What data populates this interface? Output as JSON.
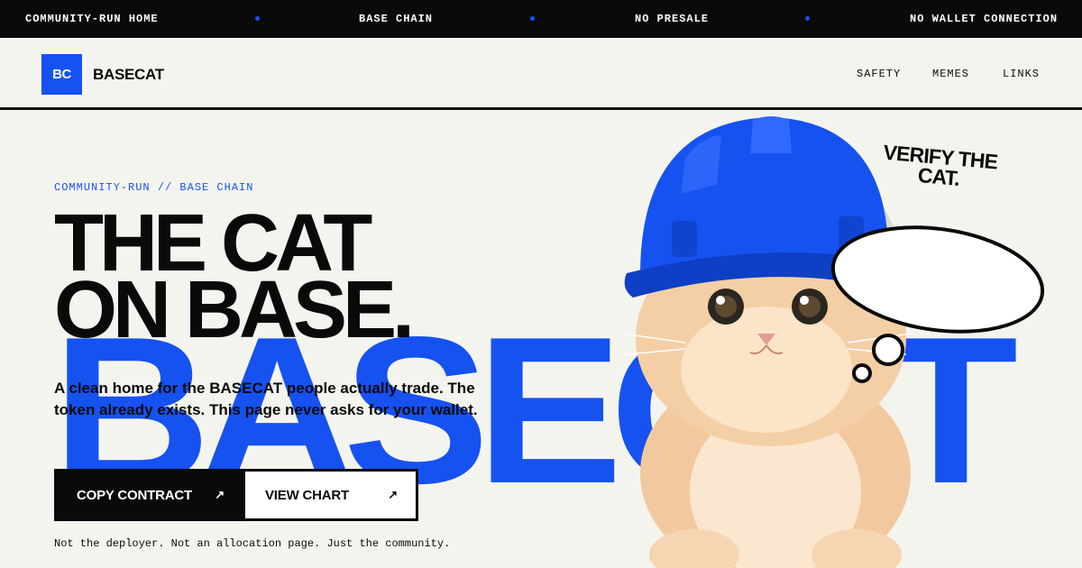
{
  "ticker": {
    "items": [
      "COMMUNITY-RUN HOME",
      "BASE CHAIN",
      "NO PRESALE",
      "NO WALLET CONNECTION"
    ]
  },
  "header": {
    "logo_text": "BC",
    "brand": "BASECAT",
    "nav": [
      "SAFETY",
      "MEMES",
      "LINKS"
    ]
  },
  "hero": {
    "kicker": "COMMUNITY-RUN // BASE CHAIN",
    "headline_line1": "THE CAT",
    "headline_line2": "ON BASE.",
    "background_word": "BASECAT",
    "lede": "A clean home for the BASECAT people actually trade. The token already exists. This page never asks for your wallet.",
    "primary_button": "COPY CONTRACT",
    "secondary_button": "VIEW CHART",
    "button_arrow": "↗",
    "footnote": "Not the deployer. Not an allocation page. Just the community.",
    "bubble_text": "VERIFY THE CAT."
  },
  "colors": {
    "accent": "#1652f0",
    "ink": "#0a0a0a",
    "paper": "#f4f4ef"
  }
}
